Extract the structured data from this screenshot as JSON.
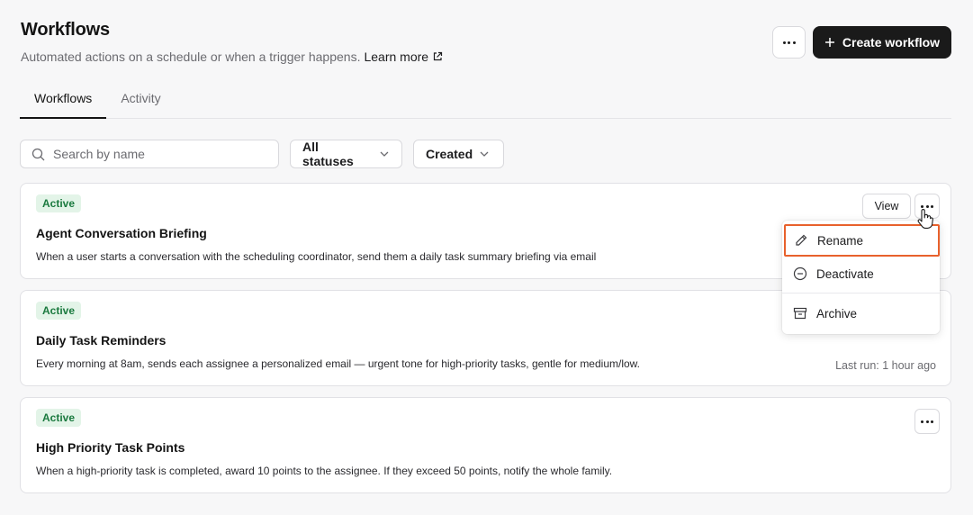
{
  "header": {
    "title": "Workflows",
    "subtitle": "Automated actions on a schedule or when a trigger happens.",
    "learn_more": "Learn more",
    "create_label": "Create workflow"
  },
  "tabs": [
    {
      "label": "Workflows",
      "active": true
    },
    {
      "label": "Activity",
      "active": false
    }
  ],
  "filters": {
    "search_placeholder": "Search by name",
    "status_label": "All statuses",
    "sort_label": "Created"
  },
  "workflows": [
    {
      "status": "Active",
      "title": "Agent Conversation Briefing",
      "description": "When a user starts a conversation with the scheduling coordinator, send them a daily task summary briefing via email",
      "view_label": "View"
    },
    {
      "status": "Active",
      "title": "Daily Task Reminders",
      "description": "Every morning at 8am, sends each assignee a personalized email — urgent tone for high-priority tasks, gentle for medium/low.",
      "last_run": "Last run: 1 hour ago"
    },
    {
      "status": "Active",
      "title": "High Priority Task Points",
      "description": "When a high-priority task is completed, award 10 points to the assignee. If they exceed 50 points, notify the whole family."
    }
  ],
  "context_menu": {
    "items": [
      {
        "label": "Rename",
        "icon": "pencil-icon"
      },
      {
        "label": "Deactivate",
        "icon": "minus-circle-icon"
      },
      {
        "label": "Archive",
        "icon": "archive-box-icon"
      }
    ],
    "highlight_color": "#e8612c"
  },
  "colors": {
    "primary_button": "#1a1a1a",
    "active_badge_bg": "#e3f4e8",
    "active_badge_text": "#1b7a3f"
  }
}
